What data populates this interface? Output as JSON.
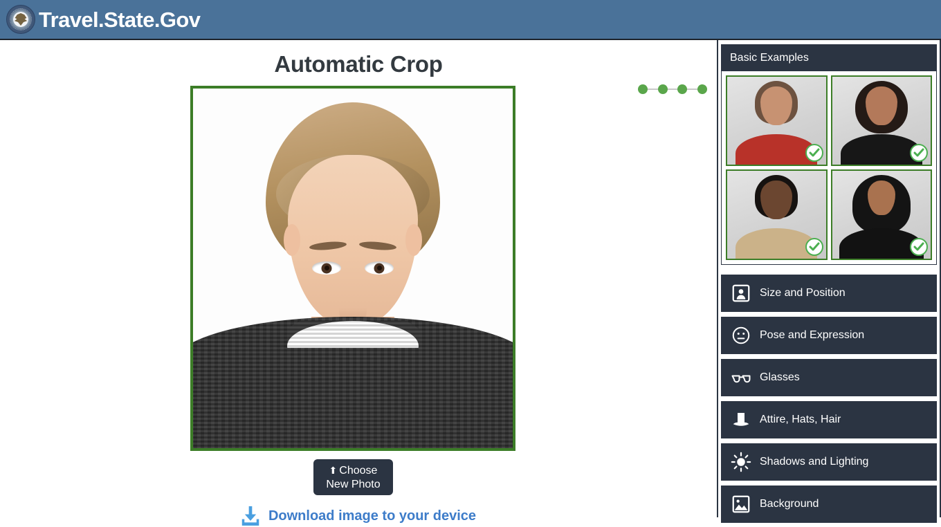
{
  "header": {
    "brand": "Travel.State.Gov",
    "seal_icon": "department-of-state-seal",
    "bg_color": "#4a7299"
  },
  "main": {
    "title": "Automatic Crop",
    "steps": {
      "count": 4,
      "dot_color": "#5aa64b",
      "items": [
        "step-1",
        "step-2",
        "step-3",
        "step-4"
      ]
    },
    "photo": {
      "alt": "Cropped passport photo of a woman with short blonde hair wearing a dark knit sweater",
      "border_color": "#3c7d27"
    },
    "choose_button": {
      "icon": "upload-icon",
      "line1": "Choose",
      "line2": "New Photo"
    },
    "download_link": {
      "icon": "download-icon",
      "label": "Download image to your device",
      "color": "#3d7cc9"
    }
  },
  "sidebar": {
    "examples": {
      "title": "Basic Examples",
      "items": [
        {
          "name": "example-photo-1",
          "badge": "check-icon",
          "skin": "#c79272",
          "hair": "#6d5240",
          "shirt": "#b83229"
        },
        {
          "name": "example-photo-2",
          "badge": "check-icon",
          "skin": "#b3795a",
          "hair": "#241a16",
          "shirt": "#171717"
        },
        {
          "name": "example-photo-3",
          "badge": "check-icon",
          "skin": "#6b4630",
          "hair": "#161210",
          "shirt": "#cbb289"
        },
        {
          "name": "example-photo-4",
          "badge": "check-icon",
          "skin": "#a9724f",
          "hair": "#141414",
          "shirt": "#121212"
        }
      ]
    },
    "menu": [
      {
        "label": "Size and Position",
        "icon": "person-frame-icon"
      },
      {
        "label": "Pose and Expression",
        "icon": "neutral-face-icon"
      },
      {
        "label": "Glasses",
        "icon": "glasses-icon"
      },
      {
        "label": "Attire, Hats, Hair",
        "icon": "top-hat-icon"
      },
      {
        "label": "Shadows and Lighting",
        "icon": "sun-icon"
      },
      {
        "label": "Background",
        "icon": "image-icon"
      }
    ]
  }
}
